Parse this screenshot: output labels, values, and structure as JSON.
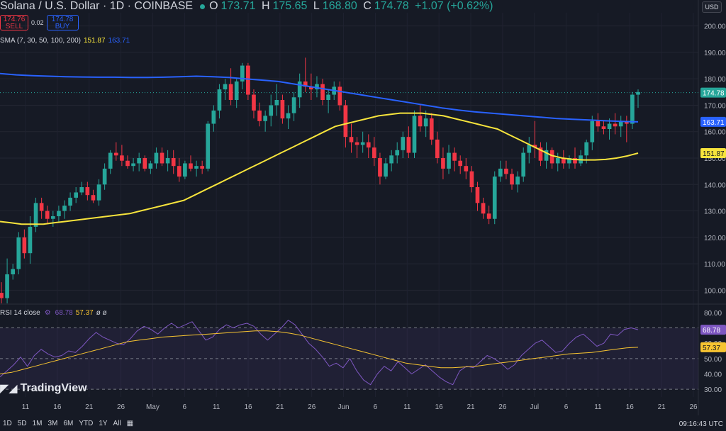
{
  "header": {
    "symbol": "Solana / U.S. Dollar · 1D · COINBASE",
    "o_label": "O",
    "o": "173.71",
    "h_label": "H",
    "h": "175.65",
    "l_label": "L",
    "l": "168.80",
    "c_label": "C",
    "c": "174.78",
    "change": "+1.07 (+0.62%)",
    "sell_price": "174.76",
    "sell_label": "SELL",
    "spread": "0.02",
    "buy_price": "174.78",
    "buy_label": "BUY",
    "currency": "USD"
  },
  "sma_legend": {
    "label": "SMA (7, 30, 50, 100, 200)",
    "v1": "151.87",
    "v2": "163.71"
  },
  "rsi_legend": {
    "label": "RSI 14 close",
    "v1": "68.78",
    "v2": "57.37",
    "extra": "ø ø"
  },
  "brand": "TradingView",
  "timeframes": [
    "1D",
    "5D",
    "1M",
    "3M",
    "6M",
    "YTD",
    "1Y",
    "All"
  ],
  "clock": "09:16:43 UTC",
  "colors": {
    "up": "#26a69a",
    "down": "#f23645",
    "sma50": "#f7e43c",
    "sma200": "#2962ff",
    "rsi": "#7e57c2",
    "rsima": "#f7c431"
  },
  "chart_data": [
    {
      "type": "candlestick",
      "title": "Solana / U.S. Dollar · 1D · COINBASE",
      "ylim": [
        95,
        205
      ],
      "yticks": [
        "200.00",
        "190.00",
        "180.00",
        "170.00",
        "160.00",
        "150.00",
        "140.00",
        "130.00",
        "120.00",
        "110.00",
        "100.00"
      ],
      "xticks": [
        "11",
        "16",
        "21",
        "26",
        "May",
        "6",
        "11",
        "16",
        "21",
        "26",
        "Jun",
        "6",
        "11",
        "16",
        "21",
        "26",
        "Jul",
        "6",
        "11",
        "16",
        "21",
        "26"
      ],
      "price_labels": {
        "last": "174.78",
        "sma200": "163.71",
        "sma50": "151.87"
      },
      "candles": [
        [
          99,
          103,
          95,
          97
        ],
        [
          97,
          112,
          95,
          106
        ],
        [
          106,
          110,
          104,
          108
        ],
        [
          108,
          122,
          106,
          120
        ],
        [
          120,
          123,
          112,
          114
        ],
        [
          114,
          128,
          110,
          124
        ],
        [
          124,
          135,
          122,
          133
        ],
        [
          133,
          135,
          127,
          130
        ],
        [
          130,
          132,
          125,
          127
        ],
        [
          127,
          130,
          124,
          128
        ],
        [
          128,
          132,
          126,
          130
        ],
        [
          130,
          134,
          127,
          132
        ],
        [
          132,
          137,
          130,
          135
        ],
        [
          135,
          139,
          133,
          137
        ],
        [
          137,
          141,
          136,
          139
        ],
        [
          139,
          141,
          134,
          136
        ],
        [
          136,
          138,
          133,
          134
        ],
        [
          134,
          142,
          132,
          140
        ],
        [
          140,
          148,
          138,
          146
        ],
        [
          146,
          153,
          144,
          152
        ],
        [
          152,
          156,
          149,
          151
        ],
        [
          151,
          155,
          147,
          149
        ],
        [
          149,
          151,
          146,
          147
        ],
        [
          147,
          150,
          145,
          148
        ],
        [
          148,
          152,
          145,
          150
        ],
        [
          150,
          151,
          145,
          146
        ],
        [
          146,
          149,
          144,
          148
        ],
        [
          148,
          154,
          146,
          152
        ],
        [
          152,
          154,
          147,
          148
        ],
        [
          148,
          153,
          145,
          150
        ],
        [
          150,
          153,
          144,
          147
        ],
        [
          147,
          150,
          141,
          143
        ],
        [
          143,
          149,
          142,
          148
        ],
        [
          148,
          151,
          145,
          146
        ],
        [
          146,
          149,
          143,
          147
        ],
        [
          147,
          149,
          144,
          146
        ],
        [
          146,
          164,
          145,
          163
        ],
        [
          163,
          170,
          160,
          168
        ],
        [
          168,
          178,
          165,
          176
        ],
        [
          176,
          180,
          172,
          178
        ],
        [
          178,
          184,
          170,
          172
        ],
        [
          172,
          180,
          169,
          179
        ],
        [
          179,
          186,
          176,
          185
        ],
        [
          185,
          186,
          172,
          174
        ],
        [
          174,
          176,
          165,
          168
        ],
        [
          168,
          171,
          162,
          164
        ],
        [
          164,
          168,
          160,
          166
        ],
        [
          166,
          174,
          162,
          170
        ],
        [
          170,
          178,
          166,
          172
        ],
        [
          172,
          174,
          163,
          165
        ],
        [
          165,
          170,
          161,
          167
        ],
        [
          167,
          175,
          164,
          173
        ],
        [
          173,
          182,
          169,
          179
        ],
        [
          179,
          188,
          175,
          177
        ],
        [
          177,
          182,
          172,
          176
        ],
        [
          176,
          181,
          173,
          178
        ],
        [
          178,
          180,
          170,
          172
        ],
        [
          172,
          176,
          167,
          174
        ],
        [
          174,
          179,
          172,
          177
        ],
        [
          177,
          179,
          168,
          170
        ],
        [
          170,
          172,
          154,
          158
        ],
        [
          158,
          163,
          152,
          156
        ],
        [
          156,
          158,
          150,
          155
        ],
        [
          155,
          160,
          152,
          156
        ],
        [
          156,
          159,
          150,
          154
        ],
        [
          154,
          158,
          147,
          150
        ],
        [
          150,
          152,
          140,
          143
        ],
        [
          143,
          150,
          142,
          148
        ],
        [
          148,
          153,
          145,
          151
        ],
        [
          151,
          156,
          148,
          153
        ],
        [
          153,
          160,
          150,
          158
        ],
        [
          158,
          162,
          150,
          152
        ],
        [
          152,
          168,
          150,
          166
        ],
        [
          166,
          170,
          160,
          162
        ],
        [
          162,
          168,
          158,
          165
        ],
        [
          165,
          167,
          155,
          157
        ],
        [
          157,
          160,
          148,
          150
        ],
        [
          150,
          154,
          142,
          146
        ],
        [
          146,
          155,
          144,
          152
        ],
        [
          152,
          154,
          145,
          149
        ],
        [
          149,
          151,
          144,
          147
        ],
        [
          147,
          150,
          142,
          145
        ],
        [
          145,
          147,
          137,
          139
        ],
        [
          139,
          141,
          130,
          133
        ],
        [
          133,
          135,
          127,
          129
        ],
        [
          129,
          132,
          125,
          127
        ],
        [
          127,
          145,
          125,
          143
        ],
        [
          143,
          149,
          141,
          146
        ],
        [
          146,
          149,
          142,
          144
        ],
        [
          144,
          146,
          138,
          140
        ],
        [
          140,
          145,
          137,
          143
        ],
        [
          143,
          154,
          141,
          152
        ],
        [
          152,
          158,
          148,
          155
        ],
        [
          155,
          164,
          150,
          154
        ],
        [
          154,
          156,
          147,
          149
        ],
        [
          149,
          156,
          146,
          153
        ],
        [
          153,
          154,
          146,
          148
        ],
        [
          148,
          152,
          145,
          150
        ],
        [
          150,
          153,
          146,
          148
        ],
        [
          148,
          151,
          146,
          150
        ],
        [
          150,
          154,
          146,
          148
        ],
        [
          148,
          153,
          147,
          151
        ],
        [
          151,
          157,
          148,
          156
        ],
        [
          156,
          166,
          153,
          164
        ],
        [
          164,
          167,
          160,
          162
        ],
        [
          162,
          164,
          159,
          161
        ],
        [
          161,
          165,
          157,
          163
        ],
        [
          163,
          167,
          159,
          162
        ],
        [
          162,
          166,
          158,
          164
        ],
        [
          164,
          166,
          156,
          163
        ],
        [
          163,
          175,
          161,
          174
        ],
        [
          174,
          176,
          169,
          175
        ]
      ],
      "sma50": [
        126,
        125.5,
        125,
        125,
        125,
        125.5,
        126,
        126.5,
        127,
        127.5,
        128,
        128.5,
        129,
        130,
        131,
        132,
        133,
        134,
        136,
        138,
        140,
        142,
        144,
        146,
        148,
        150,
        152,
        154,
        156,
        158,
        160,
        162,
        163,
        164,
        165,
        166,
        166.5,
        167,
        167,
        167,
        166.5,
        166,
        165,
        164,
        163,
        162,
        161,
        159,
        157,
        155,
        153,
        151,
        150,
        149.5,
        149.3,
        149.3,
        149.5,
        150,
        150.8,
        151.87
      ],
      "sma200": [
        182,
        181.5,
        181.2,
        181,
        180.8,
        180.7,
        180.6,
        180.6,
        180.5,
        180.5,
        180.6,
        180.8,
        181,
        180.8,
        180.5,
        180,
        179.5,
        179,
        178,
        177,
        176,
        175,
        174,
        173,
        172,
        171,
        170,
        169,
        168.2,
        167.5,
        167,
        166.5,
        166,
        165.5,
        165,
        164.7,
        164.4,
        164.1,
        163.9,
        163.71
      ],
      "rsi": [
        38,
        42,
        46,
        51,
        45,
        52,
        56,
        53,
        51,
        52,
        55,
        54,
        58,
        63,
        67,
        64,
        62,
        60,
        59,
        63,
        68,
        71,
        69,
        66,
        70,
        73,
        70,
        72,
        74,
        68,
        62,
        64,
        69,
        72,
        70,
        72,
        73,
        71,
        66,
        62,
        66,
        70,
        75,
        72,
        66,
        60,
        56,
        51,
        45,
        47,
        44,
        50,
        42,
        36,
        33,
        40,
        45,
        42,
        48,
        44,
        40,
        43,
        46,
        42,
        38,
        35,
        33,
        42,
        45,
        44,
        48,
        52,
        50,
        47,
        43,
        46,
        52,
        56,
        60,
        62,
        58,
        54,
        55,
        60,
        64,
        66,
        62,
        58,
        60,
        66,
        65,
        69,
        70,
        68.78
      ],
      "rsi_ma": [
        40,
        41,
        43,
        45,
        47,
        49,
        51,
        53,
        55,
        57,
        59,
        61,
        62,
        63,
        64,
        64.5,
        65,
        65.5,
        66,
        66.5,
        67,
        67.5,
        68,
        68,
        67.5,
        66.5,
        65,
        63,
        61,
        59,
        57,
        55,
        53,
        51,
        49,
        47,
        46,
        45,
        44,
        44,
        44.5,
        45,
        46,
        47,
        48,
        49,
        50,
        51,
        52,
        53,
        53.5,
        54,
        55,
        56,
        57,
        57.37
      ],
      "rsi_levels": [
        70,
        50,
        30
      ],
      "rsi_ylim": [
        25,
        85
      ],
      "rsi_yticks": [
        "80.00",
        "70.00",
        "60.00",
        "50.00",
        "40.00",
        "30.00"
      ],
      "rsi_price_labels": {
        "rsi": "68.78",
        "ma": "57.37"
      }
    }
  ]
}
